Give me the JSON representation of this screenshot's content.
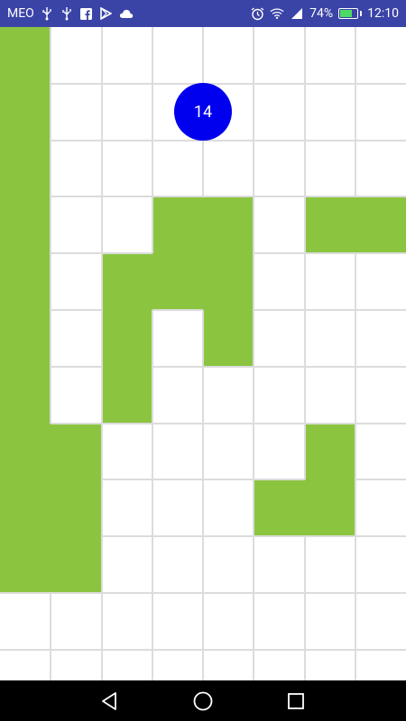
{
  "status_bar": {
    "carrier": "MEO",
    "battery_percent": "74%",
    "time": "12:10",
    "icons_left": [
      "usb-icon",
      "usb-icon",
      "facebook-icon",
      "play-store-icon",
      "cloud-icon"
    ],
    "icons_right": [
      "alarm-icon",
      "wifi-icon",
      "signal-icon",
      "battery-icon"
    ]
  },
  "game": {
    "columns": 8,
    "rows": 12,
    "colors": {
      "filled": "#8bc540",
      "empty": "#ffffff",
      "grid": "#dcdcdc",
      "player": "#0000ee"
    },
    "player": {
      "label": "14",
      "col": 3.5,
      "row": 1
    },
    "filled_cells": [
      [
        0,
        0
      ],
      [
        0,
        1
      ],
      [
        0,
        2
      ],
      [
        0,
        3
      ],
      [
        0,
        4
      ],
      [
        0,
        5
      ],
      [
        0,
        6
      ],
      [
        0,
        7
      ],
      [
        0,
        8
      ],
      [
        0,
        9
      ],
      [
        1,
        7
      ],
      [
        1,
        8
      ],
      [
        1,
        9
      ],
      [
        2,
        4
      ],
      [
        2,
        5
      ],
      [
        2,
        6
      ],
      [
        3,
        3
      ],
      [
        3,
        4
      ],
      [
        4,
        3
      ],
      [
        4,
        4
      ],
      [
        4,
        5
      ],
      [
        5,
        8
      ],
      [
        6,
        3
      ],
      [
        6,
        7
      ],
      [
        6,
        8
      ],
      [
        7,
        3
      ]
    ]
  },
  "nav_bar": {
    "buttons": [
      "back-icon",
      "home-icon",
      "recents-icon"
    ]
  }
}
